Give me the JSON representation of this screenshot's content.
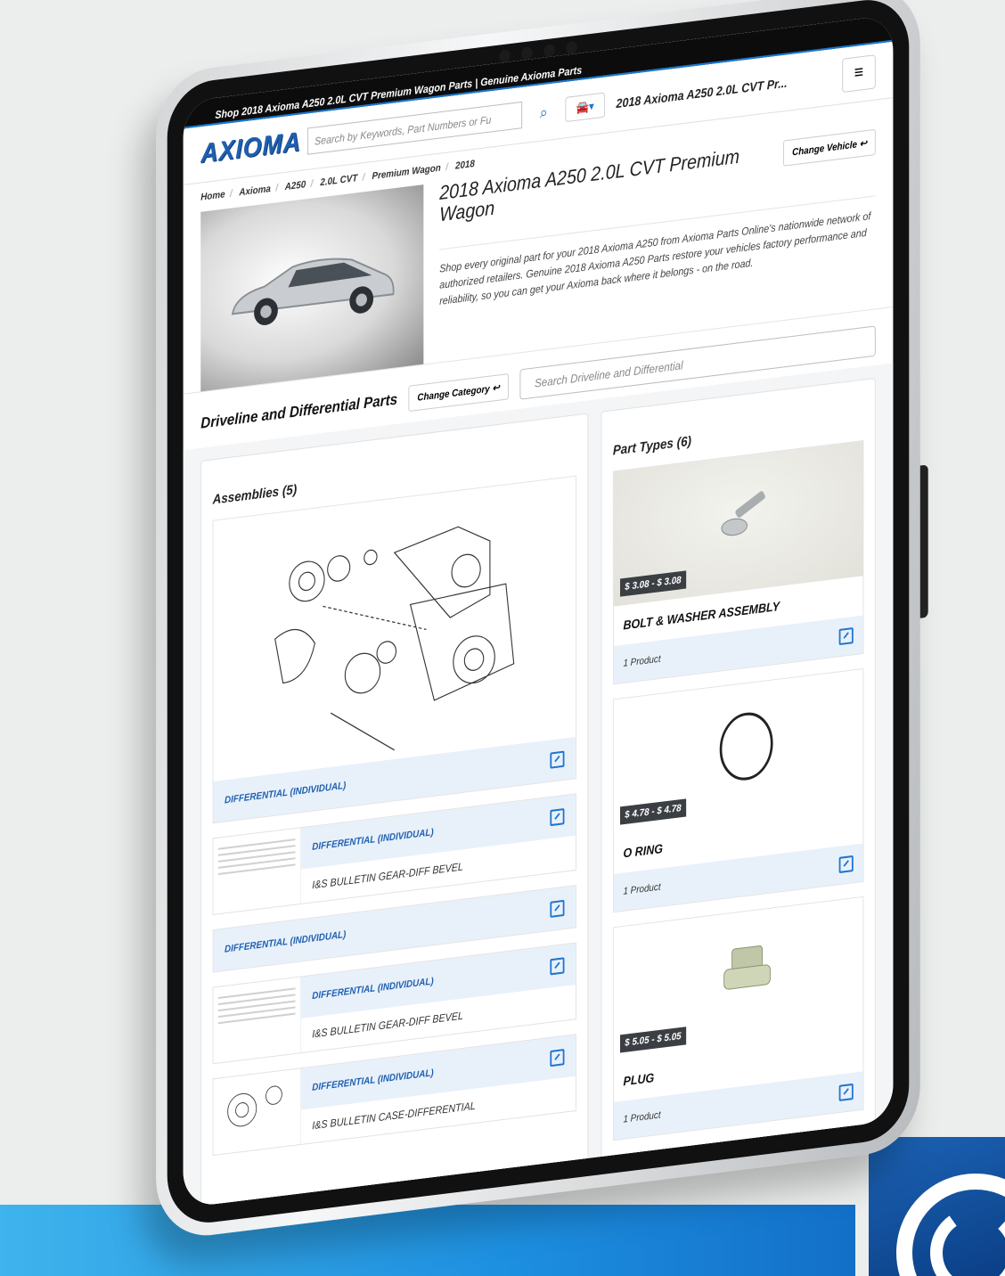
{
  "browser": {
    "title": "Shop 2018 Axioma A250 2.0L CVT Premium Wagon Parts | Genuine Axioma Parts"
  },
  "header": {
    "logo": "AXIOMA",
    "search_placeholder": "Search by Keywords, Part Numbers or Fu",
    "vehicle_title": "2018 Axioma A250 2.0L CVT Pr..."
  },
  "breadcrumbs": [
    "Home",
    "Axioma",
    "A250",
    "2.0L CVT",
    "Premium Wagon",
    "2018"
  ],
  "vehicle": {
    "title": "2018 Axioma A250 2.0L CVT Premium Wagon",
    "change_label": "Change Vehicle",
    "description": "Shop every original part for your 2018 Axioma A250 from Axioma Parts Online's nationwide network of authorized retailers. Genuine 2018 Axioma A250 Parts restore your vehicles factory performance and reliability, so you can get your Axioma back where it belongs - on the road."
  },
  "category": {
    "title": "Driveline and Differential Parts",
    "change_label": "Change Category",
    "search_placeholder": "Search Driveline and Differential"
  },
  "assemblies": {
    "heading": "Assemblies (5)",
    "items": [
      {
        "name": "DIFFERENTIAL (INDIVIDUAL)"
      },
      {
        "name": "DIFFERENTIAL (INDIVIDUAL)",
        "sub": "I&S BULLETIN GEAR-DIFF BEVEL"
      },
      {
        "name": "DIFFERENTIAL (INDIVIDUAL)"
      },
      {
        "name": "DIFFERENTIAL (INDIVIDUAL)",
        "sub": "I&S BULLETIN GEAR-DIFF BEVEL"
      },
      {
        "name": "DIFFERENTIAL (INDIVIDUAL)",
        "sub": "I&S BULLETIN CASE-DIFFERENTIAL"
      }
    ]
  },
  "part_types": {
    "heading": "Part Types (6)",
    "items": [
      {
        "name": "BOLT & WASHER ASSEMBLY",
        "price": "$ 3.08 - $ 3.08",
        "count": "1 Product"
      },
      {
        "name": "O RING",
        "price": "$ 4.78 - $ 4.78",
        "count": "1 Product"
      },
      {
        "name": "PLUG",
        "price": "$ 5.05 - $ 5.05",
        "count": "1 Product"
      }
    ]
  },
  "colors": {
    "accent": "#1f74d0",
    "band": "#1d8fe0",
    "brand_box": "#0b3f86"
  }
}
